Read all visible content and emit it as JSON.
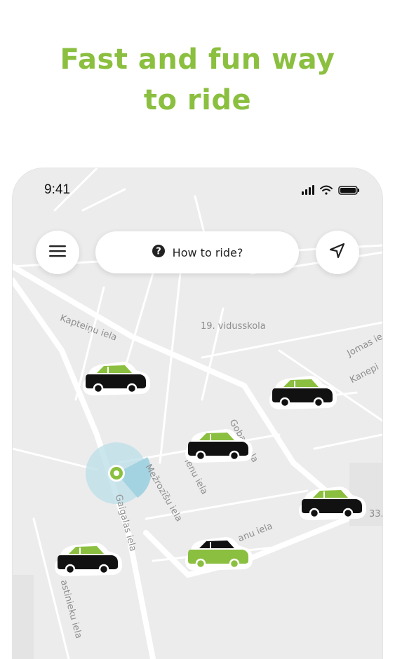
{
  "headline": {
    "line1": "Fast and fun way",
    "line2": "to ride"
  },
  "status_bar": {
    "time": "9:41",
    "icons": [
      "signal-icon",
      "wifi-icon",
      "battery-icon"
    ]
  },
  "toolbar": {
    "menu_icon": "menu-icon",
    "help_label": "How to ride?",
    "help_icon": "question-icon",
    "locate_icon": "navigation-arrow-icon"
  },
  "map": {
    "labels": {
      "kapteinu": "Kapteiņu iela",
      "school": "19. vidusskola",
      "jomas": "Jomas ie",
      "kanepi": "Kanepi",
      "gobas": "Gobas iela",
      "mezrozisu": "Mežrozīšu iela",
      "lienu": "ienu iela",
      "gaigalas": "Gaigalas iela",
      "anu": "anu iela",
      "number": "33.",
      "astinieku": "astinieku iela"
    },
    "cars": [
      {
        "name": "car-1",
        "selected": false
      },
      {
        "name": "car-2",
        "selected": false
      },
      {
        "name": "car-3",
        "selected": false
      },
      {
        "name": "car-4",
        "selected": false
      },
      {
        "name": "car-5",
        "selected": true
      },
      {
        "name": "car-6",
        "selected": false
      }
    ]
  },
  "colors": {
    "accent": "#8bbf3f",
    "car_body": "#111111",
    "map_bg": "#ececec",
    "location": "#8bbf3f"
  }
}
